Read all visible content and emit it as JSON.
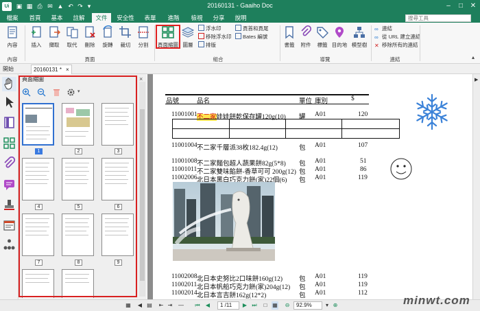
{
  "titlebar": {
    "app_icon": "Ui",
    "title": "20160131 - Gaaiho Doc",
    "min": "–",
    "max": "□",
    "close": "✕"
  },
  "menu": {
    "tabs": [
      "檔案",
      "首頁",
      "基本",
      "註解",
      "文件",
      "安全性",
      "表單",
      "進階",
      "檢視",
      "分享",
      "說明"
    ],
    "active": "文件",
    "search_placeholder": "搜尋工具"
  },
  "ribbon": {
    "content": {
      "label": "內容",
      "group": "內容"
    },
    "page_buttons": [
      "插入",
      "擷取",
      "取代",
      "刪除",
      "旋轉",
      "裁切",
      "分割"
    ],
    "page_group": "頁面",
    "combine_buttons": [
      "頁面縮圖",
      "圖層"
    ],
    "combine_small": [
      "浮水印",
      "移除浮水印",
      "頁首和頁尾",
      "Bates 編號",
      "排版"
    ],
    "combine_group": "組合",
    "nav_buttons": [
      "書籤",
      "附件",
      "標籤",
      "目的地",
      "模型樹"
    ],
    "nav_group": "導覽",
    "link_small": [
      "連結",
      "從 URL 建立連結",
      "移除所有的連結"
    ],
    "link_group": "連結"
  },
  "subbar": {
    "left_label": "開始",
    "doc_tab": "20160131 *",
    "doc_close": "×"
  },
  "panel": {
    "title": "頁面縮圖",
    "close": "×",
    "thumb_numbers": [
      "1",
      "2",
      "3",
      "4",
      "5",
      "6",
      "7",
      "8",
      "9"
    ],
    "selected": "1"
  },
  "doc": {
    "headers": [
      "品號",
      "品名",
      "單位",
      "庫別",
      "$"
    ],
    "rows": [
      {
        "code": "11001001",
        "hl": "不二家",
        "name": "娃娃餅乾保存罐120g(10)",
        "unit": "罐",
        "wh": "A01",
        "price": "120"
      },
      {
        "code": "11001004",
        "name": "不二家千層派38枚182.4g(12)",
        "unit": "包",
        "wh": "A01",
        "price": "107"
      },
      {
        "code": "11001008",
        "name": "不二家麵包超人蔬果餅82g(5*8)",
        "unit": "包",
        "wh": "A01",
        "price": "51"
      },
      {
        "code": "11001011",
        "name": "不二家雙味餡餅-香草可可 200g(12)",
        "unit": "包",
        "wh": "A01",
        "price": "86"
      },
      {
        "code": "11002006",
        "name": "北日本黑白巧克力餅(家)22個(6)",
        "unit": "包",
        "wh": "A01",
        "price": "119"
      },
      {
        "code": "11002008",
        "name": "北日本史努比2口味餅160g(12)",
        "unit": "包",
        "wh": "A01",
        "price": "119"
      },
      {
        "code": "11002011",
        "name": "北日本帆船巧克力餅(家)204g(12)",
        "unit": "包",
        "wh": "A01",
        "price": "119"
      },
      {
        "code": "11002014",
        "name": "北日本言吉餅162g(12*2)",
        "unit": "包",
        "wh": "A01",
        "price": "112"
      }
    ]
  },
  "status": {
    "page": "1 /11",
    "zoom": "92.9%"
  },
  "watermark": "minwt.com"
}
